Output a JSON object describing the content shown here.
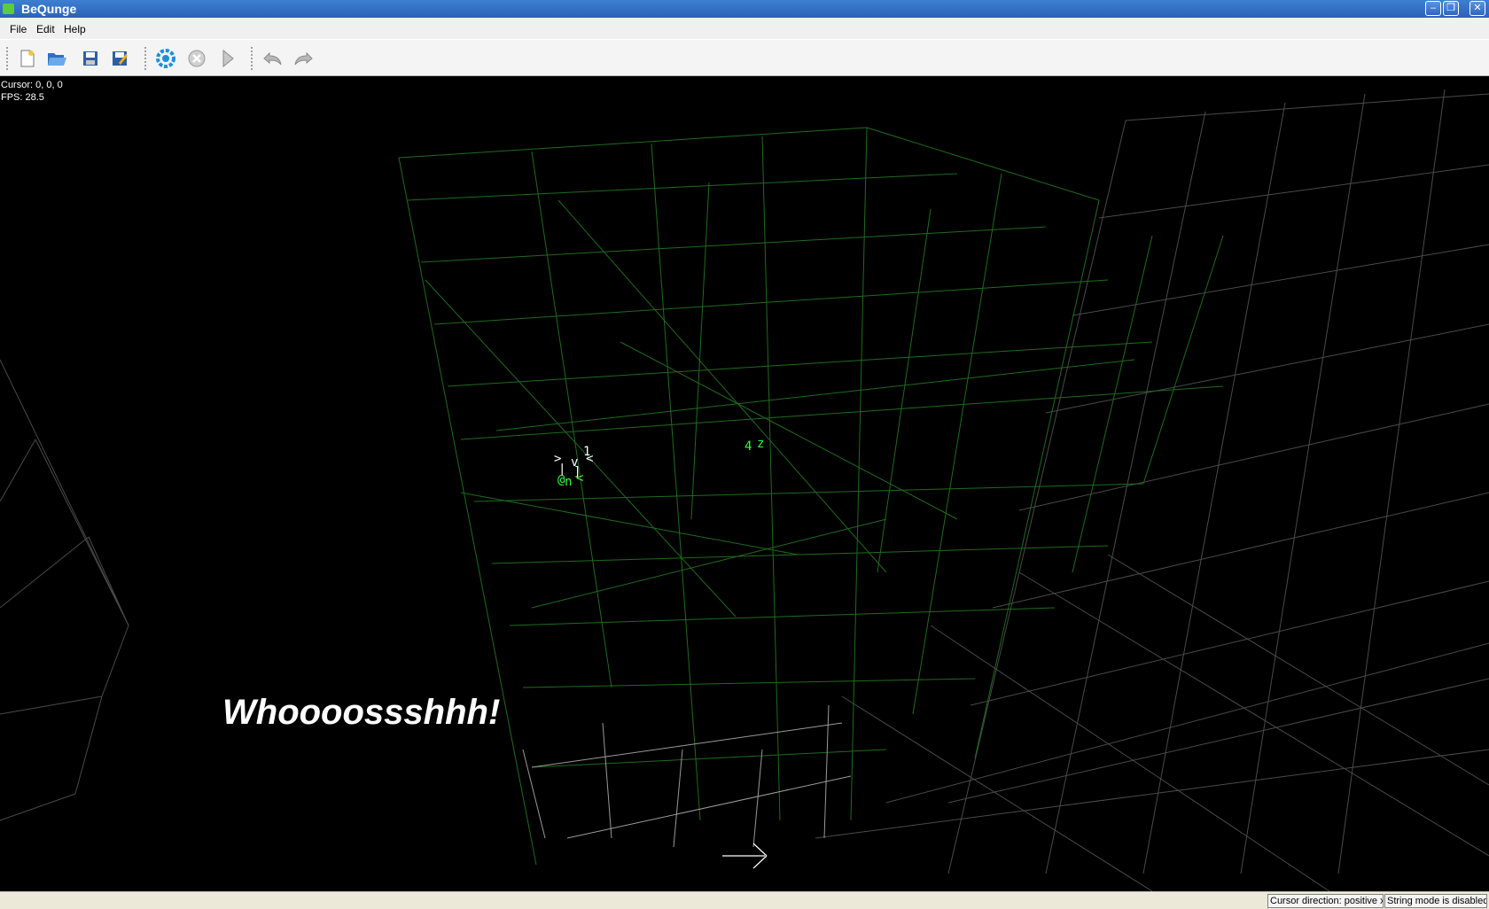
{
  "window": {
    "title": "BeQunge",
    "controls": [
      "minimize",
      "restore",
      "close"
    ]
  },
  "menu": {
    "items": [
      "File",
      "Edit",
      "Help"
    ]
  },
  "toolbar": {
    "buttons": [
      {
        "name": "new-file",
        "icon": "new-file-icon"
      },
      {
        "name": "open",
        "icon": "folder-open-icon"
      },
      {
        "name": "save",
        "icon": "floppy-save-icon"
      },
      {
        "name": "save-as",
        "icon": "floppy-save-as-icon"
      },
      {
        "name": "run",
        "icon": "gear-run-icon"
      },
      {
        "name": "stop",
        "icon": "stop-circle-icon"
      },
      {
        "name": "play",
        "icon": "play-triangle-icon"
      },
      {
        "name": "undo",
        "icon": "undo-arrow-icon"
      },
      {
        "name": "redo",
        "icon": "redo-arrow-icon"
      }
    ]
  },
  "viewport": {
    "cursor_text": "Cursor: 0, 0, 0",
    "fps_text": "FPS: 28.5",
    "overlay_text": "Whoooossshhh!",
    "grid_color": "#1f6b1f",
    "background_grid_color": "#5a5a5a",
    "glyphs": [
      {
        "char": ">",
        "color": "#ffffff"
      },
      {
        "char": "v",
        "color": "#ffffff"
      },
      {
        "char": "1",
        "color": "#ffffff"
      },
      {
        "char": "<",
        "color": "#ffffff"
      },
      {
        "char": "|",
        "color": "#ffffff"
      },
      {
        "char": "]",
        "color": "#ffffff"
      },
      {
        "char": "@",
        "color": "#33ff33"
      },
      {
        "char": "n",
        "color": "#33ff33"
      },
      {
        "char": "<",
        "color": "#33ff33"
      },
      {
        "char": "4",
        "color": "#33ff33"
      },
      {
        "char": "z",
        "color": "#33ff33"
      }
    ]
  },
  "status": {
    "direction": "Cursor direction: positive x",
    "string_mode": "String mode is disabled"
  }
}
